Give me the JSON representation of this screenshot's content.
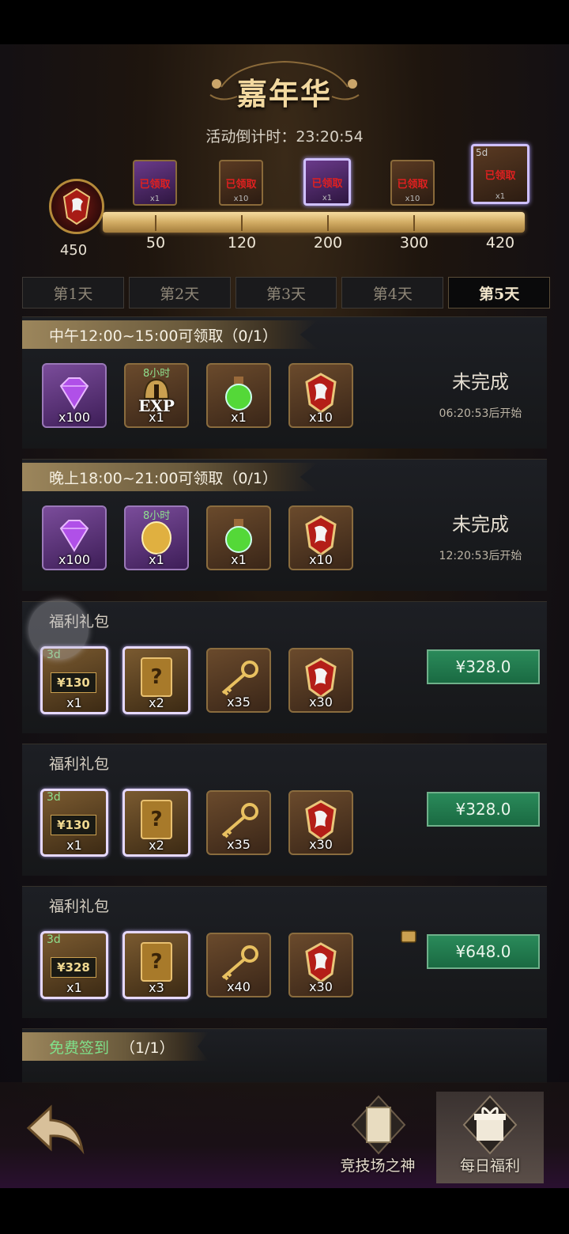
{
  "header": {
    "title": "嘉年华",
    "countdown_label": "活动倒计时：23:20:54"
  },
  "progress": {
    "current": "450",
    "milestones": [
      {
        "value": "50",
        "claimed": "已领取",
        "qty": "x1"
      },
      {
        "value": "120",
        "claimed": "已领取",
        "qty": "x10"
      },
      {
        "value": "200",
        "claimed": "已领取",
        "qty": "x1"
      },
      {
        "value": "300",
        "claimed": "已领取",
        "qty": "x10"
      },
      {
        "value": "420",
        "claimed": "已领取",
        "qty": "x1",
        "timer": "5d"
      }
    ],
    "fill_fraction": 1.0
  },
  "tabs": [
    "第1天",
    "第2天",
    "第3天",
    "第4天",
    "第5天"
  ],
  "active_tab": "第5天",
  "sections": {
    "noon": {
      "title": "中午12:00~15:00可领取（0/1）",
      "status": "未完成",
      "start": "06:20:53后开始",
      "items": [
        {
          "qty": "x100",
          "icon": "gem-icon"
        },
        {
          "qty": "x1",
          "icon": "exp-helmet-icon",
          "tag": "8小时",
          "label": "EXP"
        },
        {
          "qty": "x1",
          "icon": "potion-icon"
        },
        {
          "qty": "x10",
          "icon": "dragon-crest-icon"
        }
      ]
    },
    "evening": {
      "title": "晚上18:00~21:00可领取（0/1）",
      "status": "未完成",
      "start": "12:20:53后开始",
      "items": [
        {
          "qty": "x100",
          "icon": "gem-icon"
        },
        {
          "qty": "x1",
          "icon": "gold-coin-icon",
          "tag": "8小时"
        },
        {
          "qty": "x1",
          "icon": "potion-icon"
        },
        {
          "qty": "x10",
          "icon": "dragon-crest-icon"
        }
      ]
    },
    "pack1": {
      "title": "福利礼包",
      "price": "¥328.0",
      "items": [
        {
          "qty": "x1",
          "icon": "card-130-icon",
          "tag": "3d",
          "label": "¥130"
        },
        {
          "qty": "x2",
          "icon": "mystery-book-icon"
        },
        {
          "qty": "x35",
          "icon": "golden-key-icon"
        },
        {
          "qty": "x30",
          "icon": "dragon-crest-icon"
        }
      ]
    },
    "pack2": {
      "title": "福利礼包",
      "price": "¥328.0",
      "items": [
        {
          "qty": "x1",
          "icon": "card-130-icon",
          "tag": "3d",
          "label": "¥130"
        },
        {
          "qty": "x2",
          "icon": "mystery-book-icon"
        },
        {
          "qty": "x35",
          "icon": "golden-key-icon"
        },
        {
          "qty": "x30",
          "icon": "dragon-crest-icon"
        }
      ]
    },
    "pack3": {
      "title": "福利礼包",
      "price": "¥648.0",
      "items": [
        {
          "qty": "x1",
          "icon": "card-328-icon",
          "tag": "3d",
          "label": "¥328"
        },
        {
          "qty": "x3",
          "icon": "mystery-book-icon"
        },
        {
          "qty": "x40",
          "icon": "golden-key-icon"
        },
        {
          "qty": "x30",
          "icon": "dragon-crest-icon"
        }
      ]
    },
    "free": {
      "title_hl": "免费签到",
      "title_rest": "（1/1）"
    }
  },
  "nav": {
    "arena": "竞技场之神",
    "daily": "每日福利"
  },
  "colors": {
    "accent_gold": "#d2ac64",
    "buy_green": "#1a6a42",
    "claimed_red": "#e02020"
  }
}
